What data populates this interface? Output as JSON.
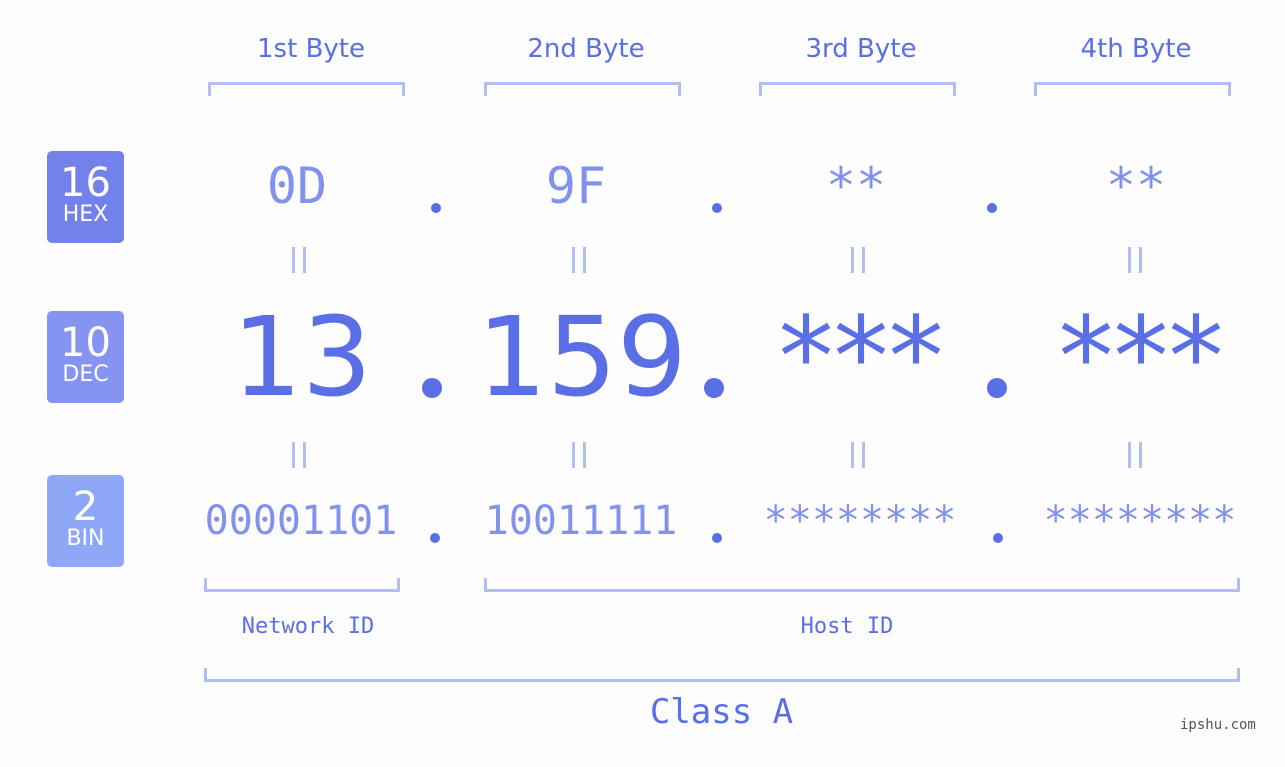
{
  "bytes": [
    {
      "label": "1st Byte",
      "hex": "0D",
      "dec": "13",
      "bin": "00001101"
    },
    {
      "label": "2nd Byte",
      "hex": "9F",
      "dec": "159",
      "bin": "10011111"
    },
    {
      "label": "3rd Byte",
      "hex": "**",
      "dec": "***",
      "bin": "********"
    },
    {
      "label": "4th Byte",
      "hex": "**",
      "dec": "***",
      "bin": "********"
    }
  ],
  "badges": {
    "hex": {
      "num": "16",
      "label": "HEX",
      "color": "#7382ea"
    },
    "dec": {
      "num": "10",
      "label": "DEC",
      "color": "#8594f0"
    },
    "bin": {
      "num": "2",
      "label": "BIN",
      "color": "#8fa7f7"
    }
  },
  "network_label": "Network ID",
  "host_label": "Host ID",
  "class_label": "Class A",
  "watermark": "ipshu.com",
  "colors": {
    "primary": "#5a6ee6",
    "secondary": "#8391ee",
    "bracket": "#b2bdf6"
  }
}
